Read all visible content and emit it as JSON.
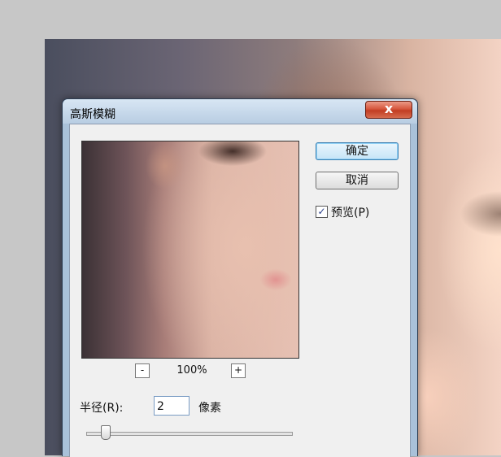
{
  "dialog": {
    "title": "高斯模糊",
    "close_label": "x",
    "ok_label": "确定",
    "cancel_label": "取消",
    "preview_label": "预览(P)",
    "preview_checked": "✓",
    "zoom": {
      "minus_label": "-",
      "plus_label": "+",
      "level": "100%"
    },
    "radius": {
      "label": "半径(R):",
      "value": "2",
      "unit": "像素"
    }
  }
}
